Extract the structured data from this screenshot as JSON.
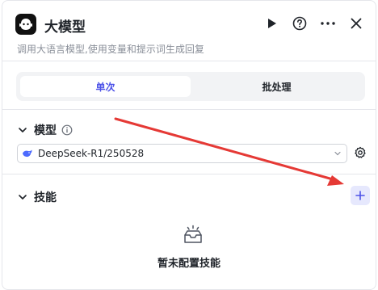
{
  "header": {
    "title": "大模型",
    "subtitle": "调用大语言模型,使用变量和提示词生成回复",
    "icons": [
      "robot-logo-icon",
      "play-icon",
      "help-icon",
      "more-icon",
      "close-icon"
    ]
  },
  "tabs": [
    {
      "label": "单次",
      "active": true
    },
    {
      "label": "批处理",
      "active": false
    }
  ],
  "model_section": {
    "title": "模型",
    "selected_model": "DeepSeek-R1/250528",
    "icons": [
      "chevron-down-icon",
      "info-icon",
      "deepseek-whale-icon",
      "settings-icon"
    ]
  },
  "skills_section": {
    "title": "技能",
    "empty_text": "暂未配置技能",
    "icons": [
      "chevron-down-icon",
      "plus-icon",
      "empty-inbox-icon"
    ]
  },
  "colors": {
    "accent": "#4d53e8",
    "annotation_arrow": "#e53935"
  }
}
